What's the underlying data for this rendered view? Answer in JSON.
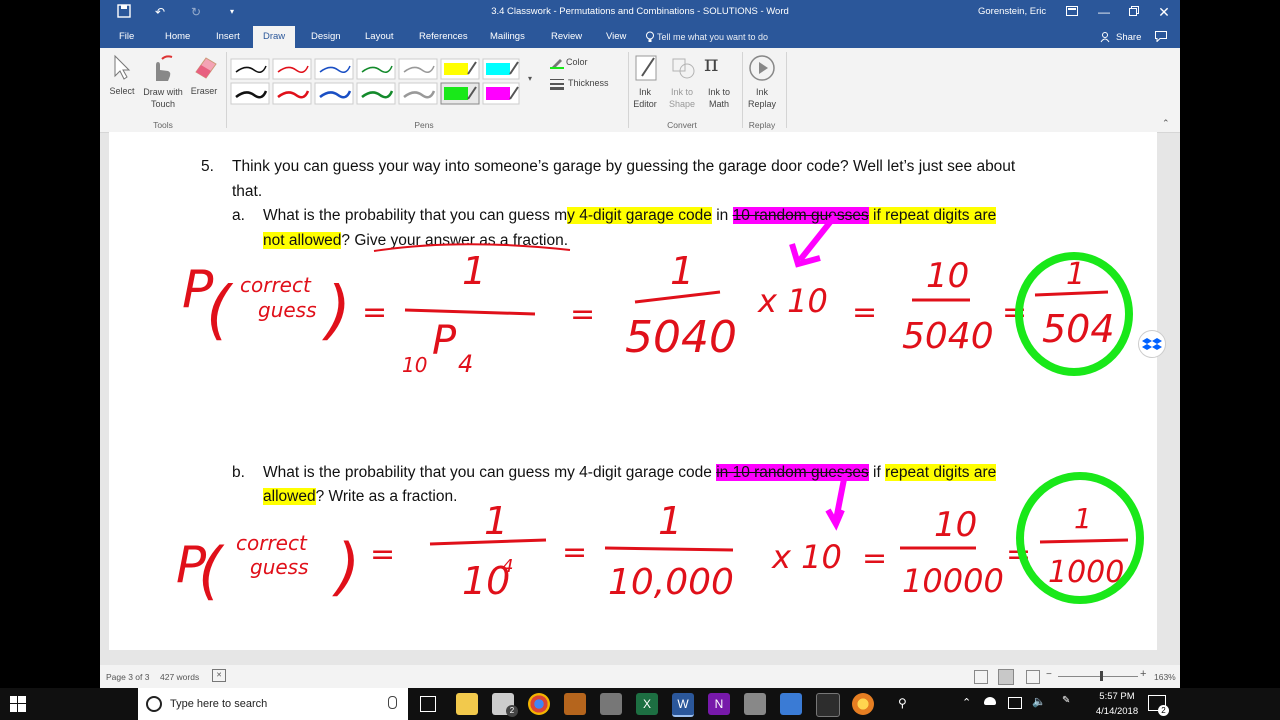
{
  "window": {
    "title": "3.4 Classwork - Permutations and Combinations - SOLUTIONS  -  Word",
    "user": "Gorenstein, Eric"
  },
  "tabs": [
    "File",
    "Home",
    "Insert",
    "Draw",
    "Design",
    "Layout",
    "References",
    "Mailings",
    "Review",
    "View"
  ],
  "tell_me": "Tell me what you want to do",
  "share": "Share",
  "ribbon": {
    "select": "Select",
    "draw_touch": "Draw with Touch",
    "eraser": "Eraser",
    "tools_group": "Tools",
    "pens_group": "Pens",
    "color": "Color",
    "thickness": "Thickness",
    "ink_editor": "Ink Editor",
    "ink_shape": "Ink to Shape",
    "ink_math": "Ink to Math",
    "ink_replay": "Ink Replay",
    "convert_group": "Convert",
    "replay_group": "Replay"
  },
  "doc": {
    "q_num": "5.",
    "q_line1": "Think you can guess your way into someone’s garage by guessing the garage door code? Well let’s just see about",
    "q_line2": "that.",
    "a_label": "a.",
    "a_p1": "What is the probability that you can guess m",
    "a_p2": "y 4-digit garage code",
    "a_p3": " in ",
    "a_p4": "10 random guesses",
    "a_p5": " if repeat digits are",
    "a_l2_1": "not allowed",
    "a_l2_2": "? Give your answer as a fraction.",
    "b_label": "b.",
    "b_p1": "What is the probability that you can guess my 4-digit garage code ",
    "b_p2": "in 10 random guesses",
    "b_p3": " if ",
    "b_p4": "repeat digits are",
    "b_l2_1": "allowed",
    "b_l2_2": "? Write as a fraction.",
    "ink_a": {
      "p": "P",
      "correct": "correct",
      "guess": "guess",
      "eq1_num": "1",
      "eq1_den_sub1": "10",
      "eq1_den_P": "P",
      "eq1_den_sub2": "4",
      "eq2_num": "1",
      "eq2_den": "5040",
      "times": "x 10",
      "eq3_num": "10",
      "eq3_den": "5040",
      "ans_num": "1",
      "ans_den": "504"
    },
    "ink_b": {
      "p": "P",
      "correct": "correct",
      "guess": "guess",
      "eq1_num": "1",
      "eq1_den": "10",
      "eq1_exp": "4",
      "eq2_num": "1",
      "eq2_den": "10,000",
      "times": "x 10",
      "eq3_num": "10",
      "eq3_den": "10000",
      "ans_num": "1",
      "ans_den": "1000"
    }
  },
  "status": {
    "page": "Page 3 of 3",
    "words": "427 words",
    "zoom": "163%"
  },
  "taskbar": {
    "search_placeholder": "Type here to search",
    "time": "5:57 PM",
    "date": "4/14/2018",
    "notif_count": "2",
    "mail_count": "2"
  },
  "colors": {
    "word_blue": "#2b579a",
    "ink_red": "#e0101a",
    "ink_magenta": "#ff00ff",
    "ink_green": "#19e819",
    "highlight_yellow": "#ffff00"
  }
}
